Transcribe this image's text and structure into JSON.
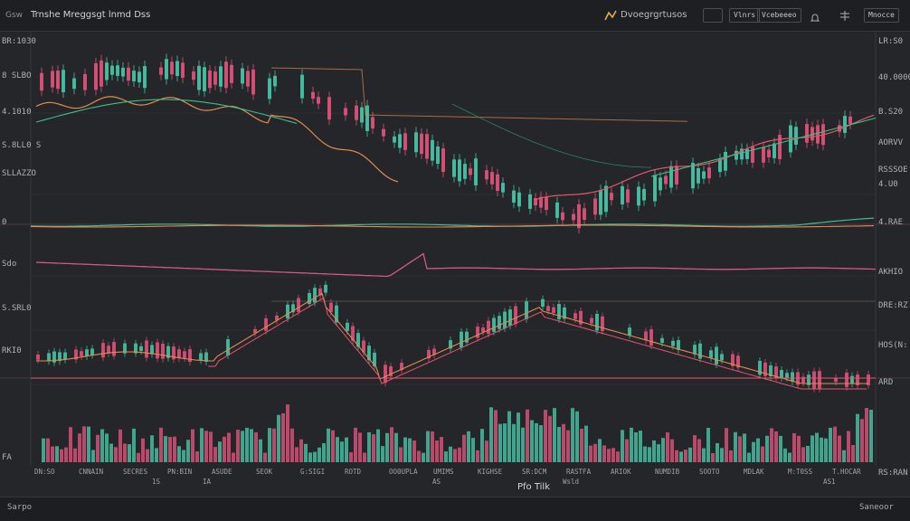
{
  "app": {
    "corner_label": "Gsw",
    "title": "Trnshe Mreggsgt lnmd Dss",
    "brand": "Dvoegrgrtusos"
  },
  "toolbar": {
    "buttons": [
      "",
      "Vlnrs",
      "Vcebeeeo",
      "",
      "",
      "Mnocce"
    ]
  },
  "colors": {
    "background": "#242629",
    "up": "#46c6a6",
    "down": "#e1527a",
    "ma_orange": "#e38a52",
    "ma_red": "#e5556e",
    "ma_green": "#3fbf8a",
    "ma_pink": "#d7578c",
    "grid": "#34373b"
  },
  "axes": {
    "left": [
      "BR:1030",
      "8 SLBO",
      "4.1010",
      "S.8LL0 S",
      "SLLAZZO",
      "0",
      "Sdo",
      "S.SRL0",
      "RKI0",
      "FA"
    ],
    "right": [
      "LR:S0",
      "40.0000",
      "B.S20",
      "AORVV",
      "RSSSOE",
      "4.U0",
      "4.RAE",
      "AKHIO",
      "DRE:RZ",
      "HOS(N:",
      "ARD",
      "RS:RAN"
    ]
  },
  "xaxis": {
    "labels": [
      "DN:SO",
      "CNNAIN",
      "SECRES",
      "PN:BIN",
      "ASUDE",
      "SEOK",
      "G:SIGI",
      "ROTD",
      "OO0UPLA",
      "UMIMS",
      "KIGHSE",
      "SR:DCM",
      "RASTFA",
      "ARIOK",
      "NUMDIB",
      "SOOTO",
      "MDLAK",
      "M:T0SS",
      "T.HOCAR"
    ],
    "sublabels": [
      "1S",
      "IA",
      "AS",
      "Wsld",
      "AS1"
    ],
    "center_title": "Pfo Tilk"
  },
  "status": {
    "left": "Sarpo",
    "right": "Saneoor"
  }
}
